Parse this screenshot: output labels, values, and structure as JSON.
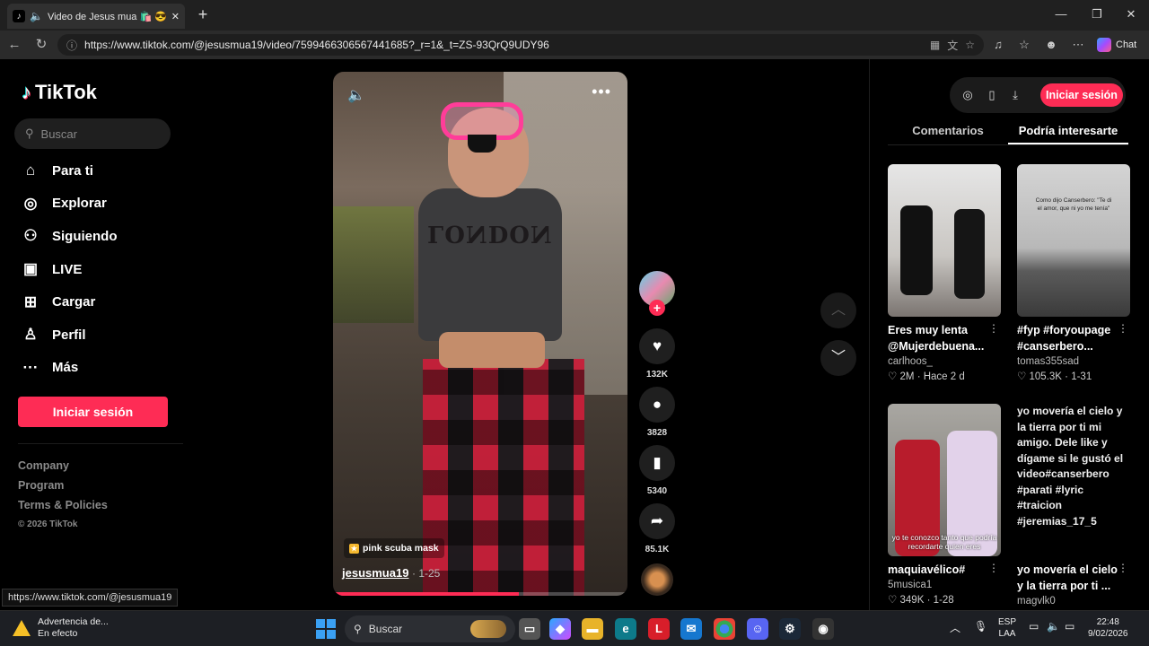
{
  "browser": {
    "tab_title": "Video de Jesus mua 🛍️ 😎 us",
    "address_url": "https://www.tiktok.com/@jesusmua19/video/7599466306567441685?_r=1&_t=ZS-93QrQ9UDY96",
    "chat_label": "Chat",
    "status_url": "https://www.tiktok.com/@jesusmua19"
  },
  "sidebar": {
    "logo": "TikTok",
    "search_placeholder": "Buscar",
    "nav": [
      {
        "label": "Para ti",
        "icon": "home-icon"
      },
      {
        "label": "Explorar",
        "icon": "compass-icon"
      },
      {
        "label": "Siguiendo",
        "icon": "user-follow-icon"
      },
      {
        "label": "LIVE",
        "icon": "live-tv-icon"
      },
      {
        "label": "Cargar",
        "icon": "upload-icon"
      },
      {
        "label": "Perfil",
        "icon": "profile-icon"
      },
      {
        "label": "Más",
        "icon": "more-icon"
      }
    ],
    "login_label": "Iniciar sesión",
    "footer": [
      "Company",
      "Program",
      "Terms & Policies"
    ],
    "copyright": "© 2026 TikTok"
  },
  "video": {
    "song": "pink scuba mask",
    "author": "jesusmua19",
    "date": "· 1-25",
    "shirt_text": "LONDON",
    "progress": 0.63
  },
  "actions": {
    "likes": "132K",
    "comments": "3828",
    "saves": "5340",
    "shares": "85.1K"
  },
  "right_panel": {
    "login_label": "Iniciar sesión",
    "tabs": [
      "Comentarios",
      "Podría interesarte"
    ],
    "active_tab": 1,
    "cards": [
      {
        "title": "Eres muy lenta @Mujerdebuena...",
        "author": "carlhoos_",
        "likes": "2M",
        "date": "Hace 2 d"
      },
      {
        "title": "#fyp #foryoupage #canserbero...",
        "author": "tomas355sad",
        "likes": "105.3K",
        "date": "1-31",
        "thumb_caption": "Como dijo Canserbero: \"Te di el amor, que ni yo me tenía\""
      },
      {
        "title": "maquiavélico#",
        "author": "5musica1",
        "likes": "349K",
        "date": "1-28",
        "thumb_caption": "yo te conozco tanto que podría recordarte quien eres"
      },
      {
        "title": "yo movería el cielo y la tierra por ti ...",
        "author": "magvlk0",
        "alt_text": "yo movería el cielo y la tierra por ti mi amigo. Dele like y dígame si le gustó el video#canserbero #parati #lyric #traicion #jeremias_17_5"
      }
    ]
  },
  "taskbar": {
    "warning_title": "Advertencia de...",
    "warning_sub": "En efecto",
    "search_label": "Buscar",
    "lang": "ESP",
    "lang_sub": "LAA",
    "time": "22:48",
    "date": "9/02/2026"
  },
  "colors": {
    "accent": "#fe2c55",
    "background": "#000000"
  }
}
